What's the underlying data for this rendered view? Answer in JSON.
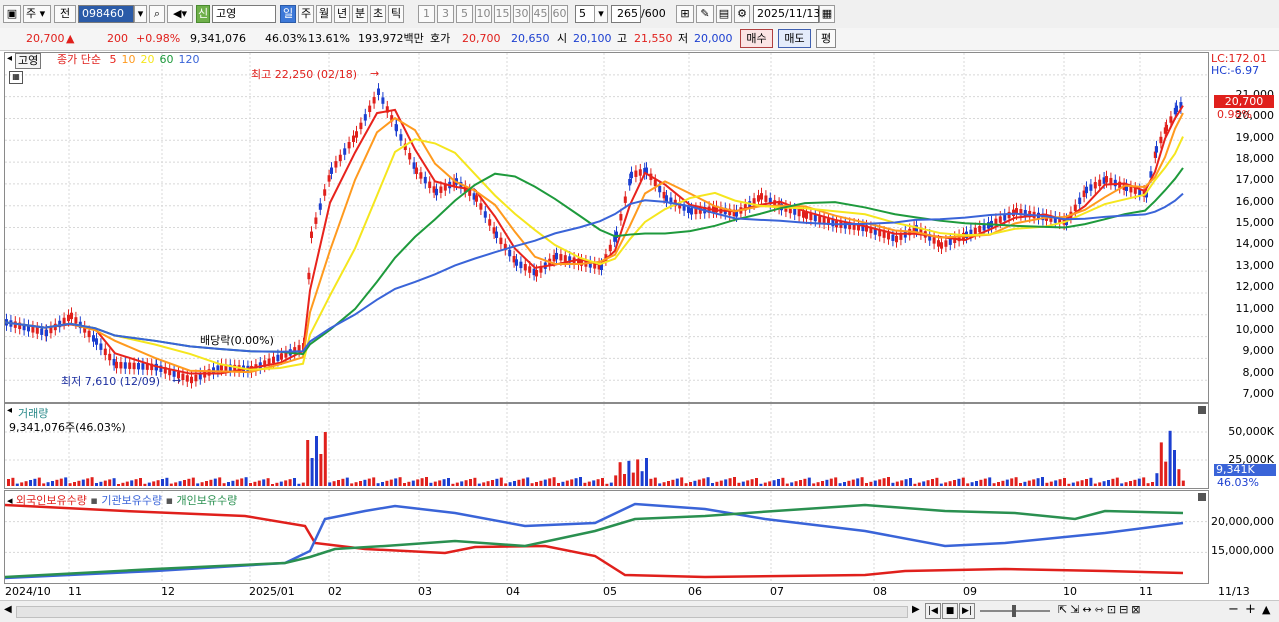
{
  "toolbar": {
    "market_label": "주",
    "prev_label": "전",
    "code": "098460",
    "badge": "신",
    "stock_name": "고영",
    "periods": [
      "일",
      "주",
      "월",
      "년",
      "분",
      "초",
      "틱"
    ],
    "numbers": [
      "1",
      "3",
      "5",
      "10",
      "15",
      "30",
      "45",
      "60"
    ],
    "count_value": "5",
    "range_value": "265",
    "range_total": "/600",
    "date": "2025/11/13"
  },
  "quote": {
    "price": "20,700",
    "change": "200",
    "change_pct": "+0.98%",
    "volume": "9,341,076",
    "vol_ratio": "46.03%",
    "turnover": "13.61%",
    "amount": "193,972백만",
    "bid_label": "호가",
    "ask_price": "20,700",
    "bid_price": "20,650",
    "open_label": "시",
    "open": "20,100",
    "high_label": "고",
    "high": "21,550",
    "low_label": "저",
    "low": "20,000",
    "buy_label": "매수",
    "sell_label": "매도",
    "eval_label": "평"
  },
  "main_pane": {
    "name_tag": "고영",
    "ma_title": "종가 단순",
    "ma_periods": [
      "5",
      "10",
      "20",
      "60",
      "120"
    ],
    "ma_colors": [
      "#e8231c",
      "#ff9a1e",
      "#f5e61e",
      "#1e9a3c",
      "#3a64d8"
    ],
    "high_annot": "최고 22,250 (02/18)",
    "low_annot": "최저 7,610 (12/09)",
    "div_annot": "배당락(0.00%)",
    "lc_label": "LC:172.01",
    "hc_label": "HC:-6.97",
    "price_tag": "20,700",
    "pct_tag": "0.98%",
    "y_ticks": [
      "21,000",
      "20,000",
      "19,000",
      "18,000",
      "17,000",
      "16,000",
      "15,000",
      "14,000",
      "13,000",
      "12,000",
      "11,000",
      "10,000",
      "9,000",
      "8,000",
      "7,000"
    ]
  },
  "volume_pane": {
    "title": "거래량",
    "value": "9,341,076주(46.03%)",
    "ticks": [
      "50,000K",
      "25,000K"
    ],
    "tag": "9,341K",
    "pct": "46.03%"
  },
  "holding_pane": {
    "legend": [
      "외국인보유수량",
      "기관보유수량",
      "개인보유수량"
    ],
    "colors": [
      "#e0201c",
      "#3a64d8",
      "#2a9050"
    ],
    "ticks": [
      "20,000,000",
      "15,000,000"
    ]
  },
  "x_axis": {
    "labels": [
      "2024/10",
      "11",
      "12",
      "2025/01",
      "02",
      "03",
      "04",
      "05",
      "06",
      "07",
      "08",
      "09",
      "10",
      "11"
    ],
    "end_label": "11/13"
  }
}
